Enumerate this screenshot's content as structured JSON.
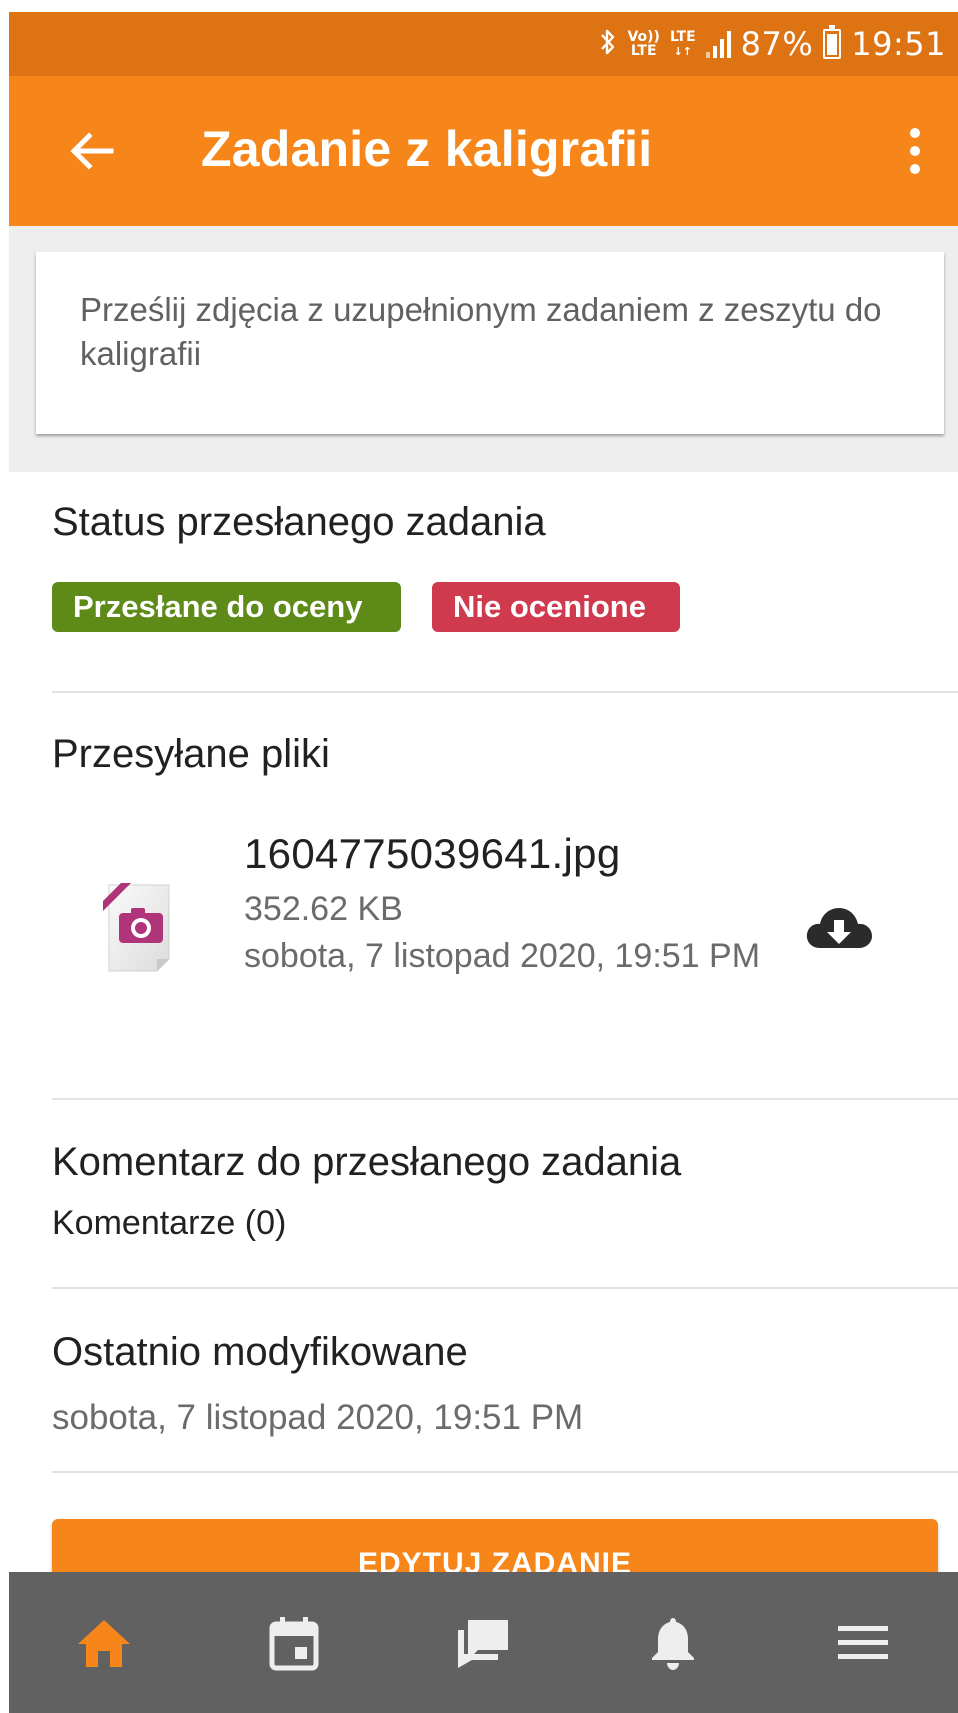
{
  "status_bar": {
    "network_top": "Vo))",
    "network_bottom": "LTE",
    "lte_label": "LTE",
    "battery": "87%",
    "time": "19:51",
    "icons": [
      "bluetooth-icon",
      "volte-icon",
      "lte-icon",
      "signal-icon",
      "battery-icon"
    ]
  },
  "app_bar": {
    "title": "Zadanie z kaligrafii",
    "back_icon": "arrow-left-icon",
    "more_icon": "more-vert-icon"
  },
  "description": "Prześlij zdjęcia z uzupełnionym zadaniem z zeszytu do kaligrafii",
  "status_section": {
    "title": "Status przesłanego zadania",
    "badges": [
      {
        "label": "Przesłane do oceny",
        "color": "#5E8A18"
      },
      {
        "label": "Nie ocenione",
        "color": "#D03A4E"
      }
    ]
  },
  "files_section": {
    "title": "Przesyłane pliki",
    "files": [
      {
        "name": "1604775039641.jpg",
        "size": "352.62 KB",
        "date": "sobota, 7 listopad 2020, 19:51 PM",
        "icon": "image-file-icon",
        "action_icon": "cloud-download-icon"
      }
    ]
  },
  "comment_section": {
    "title": "Komentarz do przesłanego zadania",
    "link": "Komentarze (0)"
  },
  "modified_section": {
    "title": "Ostatnio modyfikowane",
    "value": "sobota, 7 listopad 2020, 19:51 PM"
  },
  "edit_button": "EDYTUJ ZADANIE",
  "bottom_nav": {
    "items": [
      {
        "icon": "home-icon",
        "active": true
      },
      {
        "icon": "calendar-icon",
        "active": false
      },
      {
        "icon": "messages-icon",
        "active": false
      },
      {
        "icon": "bell-icon",
        "active": false
      },
      {
        "icon": "menu-icon",
        "active": false
      }
    ],
    "active_color": "#F7861A",
    "inactive_color": "#EEEEEE"
  },
  "colors": {
    "primary": "#F7861A",
    "status_bar": "#DD7313",
    "nav_background": "#616161"
  }
}
